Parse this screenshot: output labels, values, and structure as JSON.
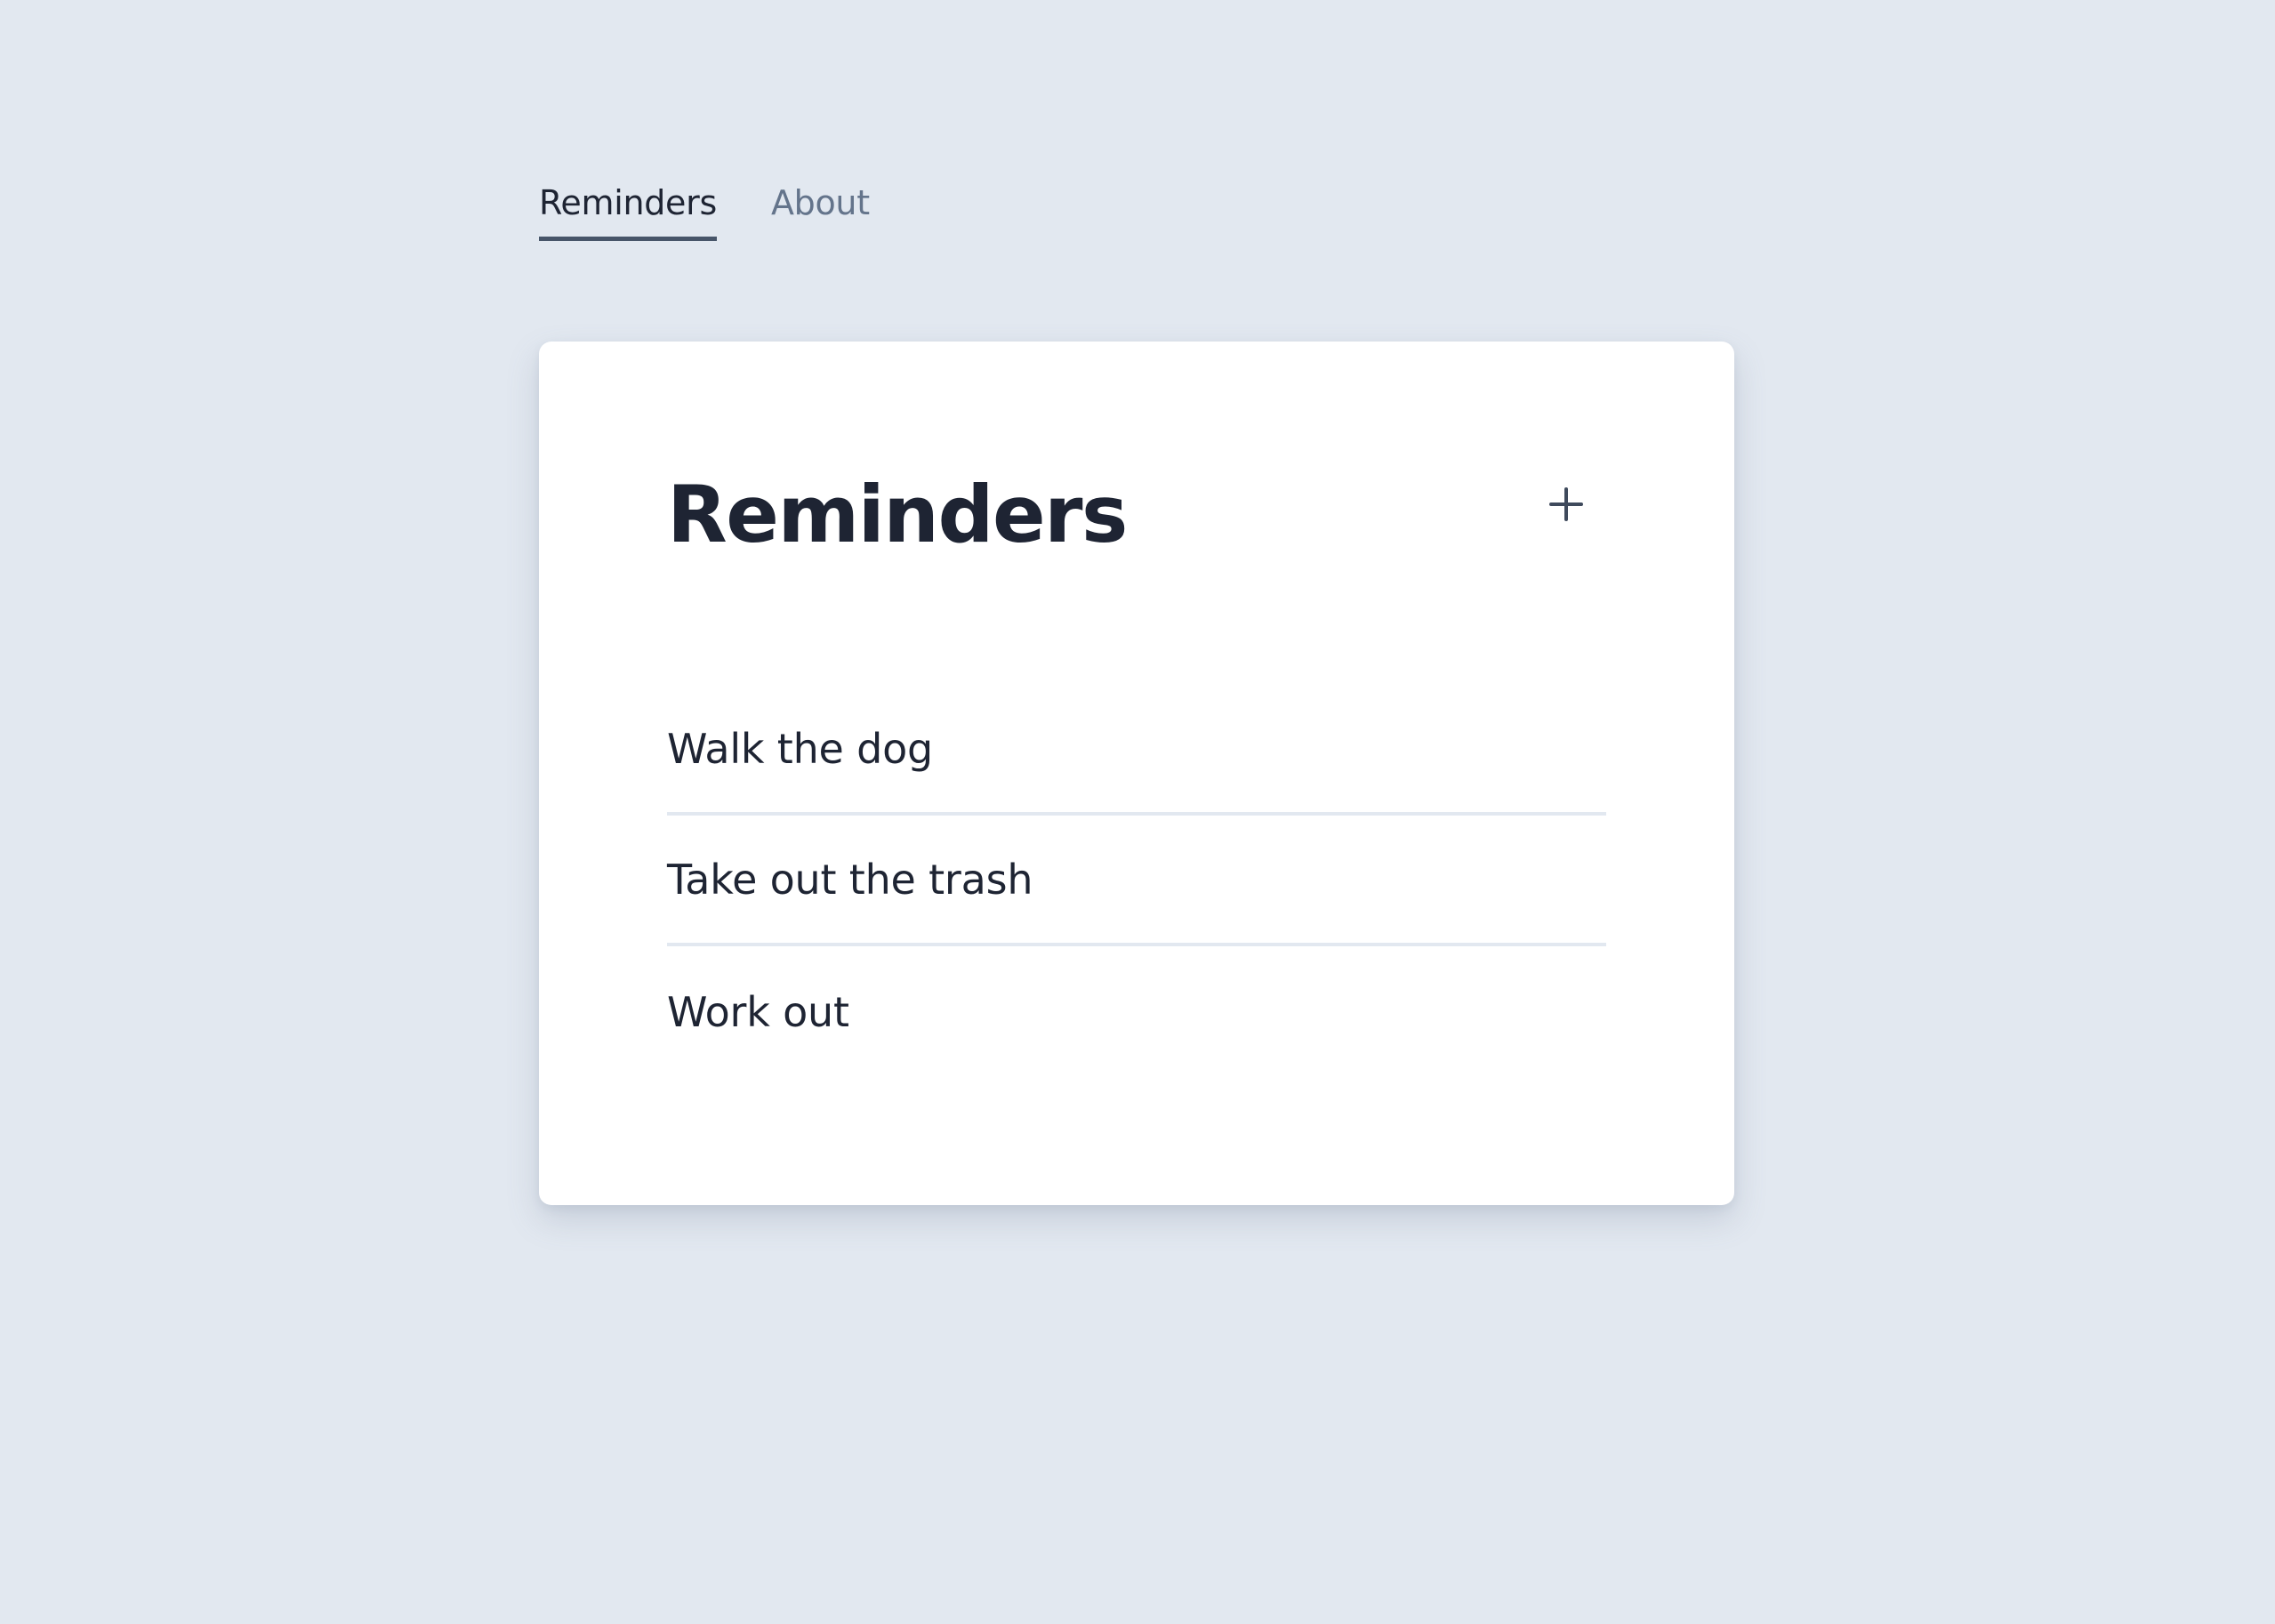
{
  "nav": {
    "tabs": [
      {
        "label": "Reminders",
        "active": true
      },
      {
        "label": "About",
        "active": false
      }
    ]
  },
  "card": {
    "title": "Reminders",
    "add_icon": "plus-icon"
  },
  "reminders": [
    {
      "text": "Walk the dog"
    },
    {
      "text": "Take out the trash"
    },
    {
      "text": "Work out"
    }
  ],
  "colors": {
    "background": "#e2e8f0",
    "card": "#ffffff",
    "text": "#1e2433",
    "muted": "#64748b",
    "accent": "#475569",
    "divider": "#e2e8f0"
  }
}
